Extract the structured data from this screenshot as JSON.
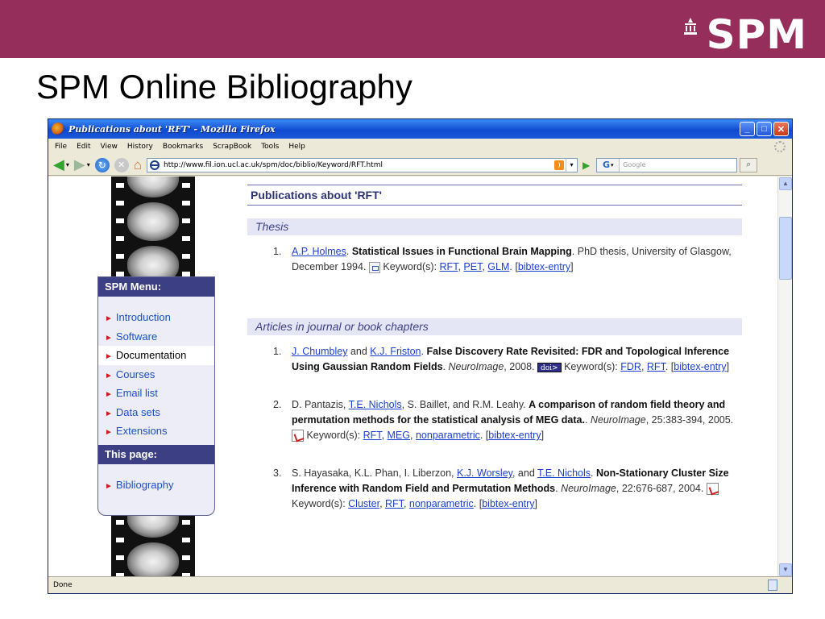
{
  "slide": {
    "title": "SPM Online Bibliography",
    "logo_text": "SPM",
    "banner_color": "#962e5c"
  },
  "browser": {
    "window_title": "Publications about 'RFT' - Mozilla Firefox",
    "menu": [
      "File",
      "Edit",
      "View",
      "History",
      "Bookmarks",
      "ScrapBook",
      "Tools",
      "Help"
    ],
    "url": "http://www.fil.ion.ucl.ac.uk/spm/doc/biblio/Keyword/RFT.html",
    "search_engine": "G",
    "search_placeholder": "Google",
    "status": "Done",
    "icons": [
      "back-icon",
      "forward-icon",
      "reload-icon",
      "stop-icon",
      "home-icon",
      "feed-icon",
      "go-icon",
      "search-icon"
    ]
  },
  "sidebar": {
    "menu_title": "SPM Menu:",
    "items": [
      {
        "label": "Introduction"
      },
      {
        "label": "Software"
      },
      {
        "label": "Documentation"
      },
      {
        "label": "Courses"
      },
      {
        "label": "Email list"
      },
      {
        "label": "Data sets"
      },
      {
        "label": "Extensions"
      }
    ],
    "page_title": "This page:",
    "page_items": [
      {
        "label": "Bibliography"
      }
    ]
  },
  "main": {
    "heading": "Publications about 'RFT'",
    "thesis": {
      "section": "Thesis",
      "entry": {
        "num": "1.",
        "author": "A.P. Holmes",
        "title": "Statistical Issues in Functional Brain Mapping",
        "desc": ". PhD thesis, University of Glasgow, December 1994. ",
        "kw_label": " Keyword(s): ",
        "keywords": [
          "RFT",
          "PET",
          "GLM"
        ],
        "bibtex": "bibtex-entry"
      }
    },
    "articles": {
      "section": "Articles in journal or book chapters",
      "entries": [
        {
          "num": "1.",
          "author1": "J. Chumbley",
          "and": " and ",
          "author2": "K.J. Friston",
          "title": "False Discovery Rate Revisited: FDR and Topological Inference Using Gaussian Random Fields",
          "journal": "NeuroImage",
          "rest": ", 2008. ",
          "badge": "doi>",
          "kw_label": " Keyword(s): ",
          "keywords": [
            "FDR",
            "RFT"
          ],
          "bibtex": "bibtex-entry"
        },
        {
          "num": "2.",
          "authors_pre": "D. Pantazis, ",
          "author_link": "T.E. Nichols",
          "authors_post": ", S. Baillet, and R.M. Leahy. ",
          "title": "A comparison of random field theory and permutation methods for the statistical analysis of MEG data.",
          "journal": "NeuroImage",
          "rest": ", 25:383-394, 2005. ",
          "kw_label": " Keyword(s): ",
          "keywords": [
            "RFT",
            "MEG",
            "nonparametric"
          ],
          "bibtex": "bibtex-entry"
        },
        {
          "num": "3.",
          "authors_pre": "S. Hayasaka, K.L. Phan, I. Liberzon, ",
          "author_link": "K.J. Worsley",
          "and": ", and ",
          "author_link2": "T.E. Nichols",
          "title": "Non-Stationary Cluster Size Inference with Random Field and Permutation Methods",
          "journal": "NeuroImage",
          "rest": ", 22:676-687, 2004. ",
          "kw_label": " Keyword(s): ",
          "keywords": [
            "Cluster",
            "RFT",
            "nonparametric"
          ],
          "bibtex": "bibtex-entry"
        }
      ]
    }
  }
}
